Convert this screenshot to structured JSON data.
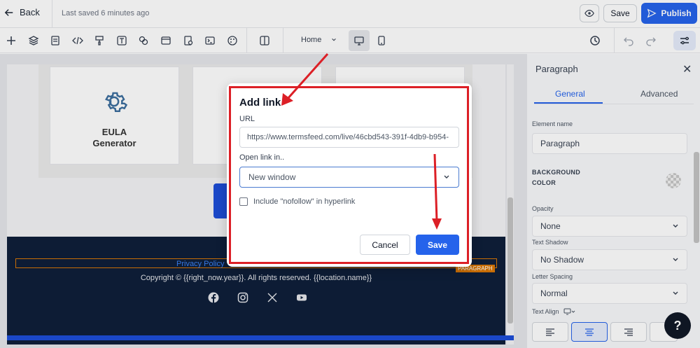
{
  "topbar": {
    "back_label": "Back",
    "saved_text": "Last saved 6 minutes ago",
    "save_label": "Save",
    "publish_label": "Publish"
  },
  "toolbar": {
    "icons": [
      "plus-icon",
      "layers-icon",
      "page-icon",
      "code-icon",
      "paint-icon",
      "text-icon",
      "shapes-icon",
      "browser-icon",
      "form-icon",
      "terminal-icon",
      "palette-icon",
      "columns-icon"
    ],
    "page_select": "Home"
  },
  "canvas": {
    "card_title": "EULA\nGenerator",
    "privacy_link": "Privacy Policy",
    "paragraph_badge": "PARAGRAPH",
    "copyright": "Copyright © {{right_now.year}}. All rights reserved. {{location.name}}",
    "social_icons": [
      "facebook-icon",
      "instagram-icon",
      "x-icon",
      "youtube-icon"
    ]
  },
  "panel": {
    "title": "Paragraph",
    "tabs": [
      "General",
      "Advanced"
    ],
    "active_tab": "General",
    "element_name_label": "Element name",
    "element_name_value": "Paragraph",
    "bg_color_label": "BACKGROUND\nCOLOR",
    "opacity_label": "Opacity",
    "opacity_value": "None",
    "text_shadow_label": "Text Shadow",
    "text_shadow_value": "No Shadow",
    "letter_spacing_label": "Letter Spacing",
    "letter_spacing_value": "Normal",
    "text_align_label": "Text Align"
  },
  "modal": {
    "title": "Add link",
    "url_label": "URL",
    "url_value": "https://www.termsfeed.com/live/46cbd543-391f-4db9-b954-",
    "open_in_label": "Open link in..",
    "open_in_value": "New window",
    "nofollow_label": "Include \"nofollow\" in hyperlink",
    "nofollow_checked": false,
    "cancel_label": "Cancel",
    "save_label": "Save"
  },
  "colors": {
    "accent": "#2563eb",
    "annotation_red": "#dc1f26",
    "footer_bg": "#0f1f3a"
  }
}
